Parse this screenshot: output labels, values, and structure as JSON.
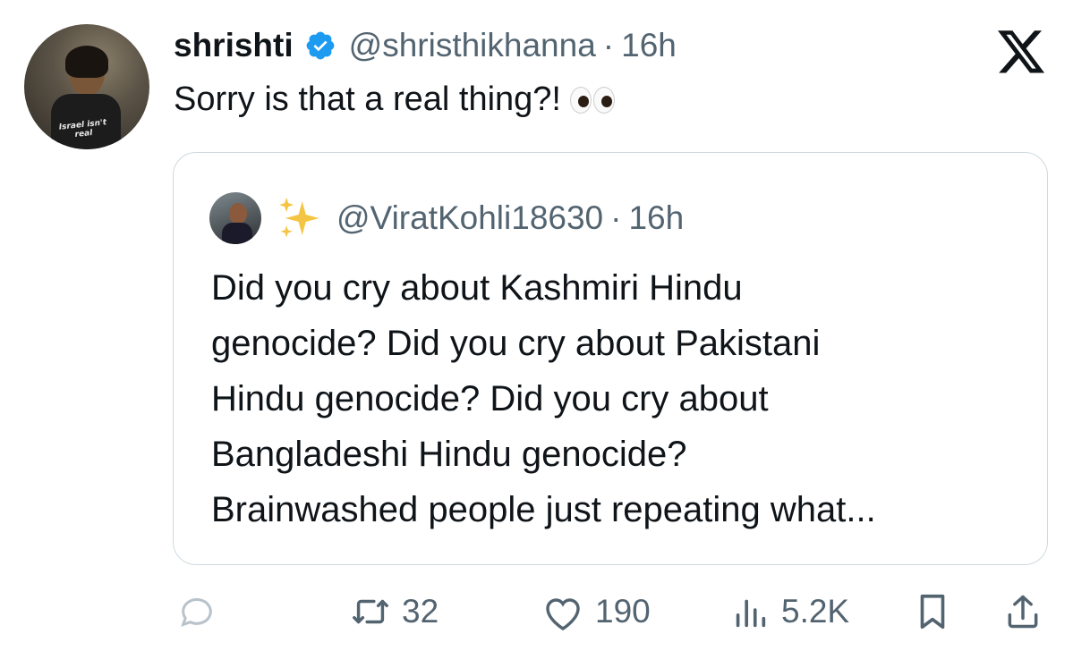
{
  "tweet": {
    "display_name": "shrishti",
    "handle": "@shristhikhanna",
    "separator": "·",
    "time": "16h",
    "text": "Sorry is that a real thing?!",
    "avatar_shirt_text": "Israel isn't real"
  },
  "quote": {
    "handle": "@ViratKohli18630",
    "separator": "·",
    "time": "16h",
    "lines": [
      "Did you cry about Kashmiri Hindu",
      "genocide? Did you cry about Pakistani",
      "Hindu genocide? Did you cry about",
      "Bangladeshi Hindu genocide?",
      "Brainwashed people just repeating what..."
    ]
  },
  "actions": {
    "reply_icon": "reply-icon",
    "retweet_count": "32",
    "like_count": "190",
    "views_count": "5.2K",
    "bookmark_icon": "bookmark-icon",
    "share_icon": "share-icon"
  },
  "colors": {
    "text_primary": "#0f1419",
    "text_secondary": "#536471",
    "verified_blue": "#1d9bf0",
    "border": "#cfd9de"
  }
}
